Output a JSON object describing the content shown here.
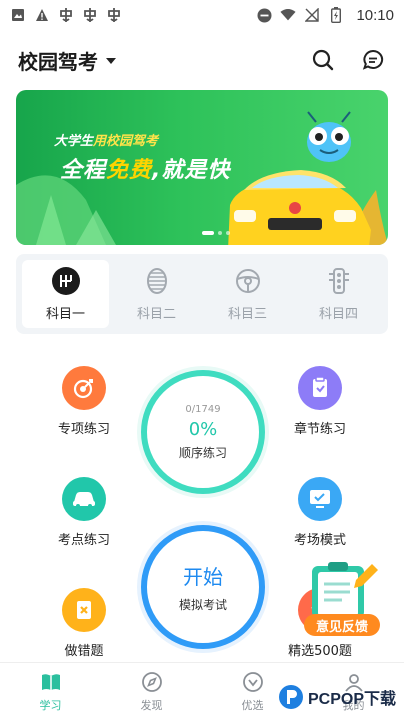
{
  "status_bar": {
    "time": "10:10",
    "left_icons": [
      "image-icon",
      "warning-icon",
      "app-icon",
      "app-icon",
      "app-icon"
    ],
    "right_icons": [
      "do-not-disturb-icon",
      "wifi-icon",
      "no-signal-icon",
      "battery-icon"
    ]
  },
  "header": {
    "title": "校园驾考",
    "icons": [
      "search-icon",
      "message-icon"
    ]
  },
  "banner": {
    "tag_prefix": "大学生",
    "tag_highlight": "用校园驾考",
    "slogan_a": "全程",
    "slogan_highlight": "免费",
    "slogan_b": ",就是快",
    "active_slide": 1,
    "slide_count": 3
  },
  "subjects": {
    "active": 0,
    "items": [
      {
        "label": "科目一",
        "icon": "gearshift-icon"
      },
      {
        "label": "科目二",
        "icon": "tire-icon"
      },
      {
        "label": "科目三",
        "icon": "steering-wheel-icon"
      },
      {
        "label": "科目四",
        "icon": "traffic-light-icon"
      }
    ]
  },
  "sequence_practice": {
    "count": "0/1749",
    "percent": "0%",
    "label": "顺序练习"
  },
  "mock_exam": {
    "start": "开始",
    "label": "模拟考试"
  },
  "features": {
    "topic_practice": {
      "label": "专项练习",
      "icon": "target-icon",
      "color": "#ff7a3d"
    },
    "chapter_practice": {
      "label": "章节练习",
      "icon": "book-icon",
      "color": "#8d7cf7"
    },
    "keypoint_practice": {
      "label": "考点练习",
      "icon": "car-icon",
      "color": "#21c7aa"
    },
    "exam_mode": {
      "label": "考场模式",
      "icon": "monitor-icon",
      "color": "#3aa8f5"
    },
    "wrong_questions": {
      "label": "做错题",
      "icon": "error-book-icon",
      "color": "#ffb21a"
    },
    "best_500": {
      "label": "精选500题"
    }
  },
  "feedback": {
    "label": "意见反馈",
    "icon": "clipboard-icon"
  },
  "tabbar": {
    "active": 0,
    "items": [
      {
        "label": "学习",
        "icon": "study-icon"
      },
      {
        "label": "发现",
        "icon": "compass-icon"
      },
      {
        "label": "优选",
        "icon": "diamond-icon"
      },
      {
        "label": "我的",
        "icon": "profile-icon"
      }
    ]
  },
  "watermark": {
    "text": "PCPOP下载"
  },
  "colors": {
    "accent": "#2bbf9e",
    "banner_green": "#23b352",
    "exam_blue": "#2f9bf7"
  }
}
